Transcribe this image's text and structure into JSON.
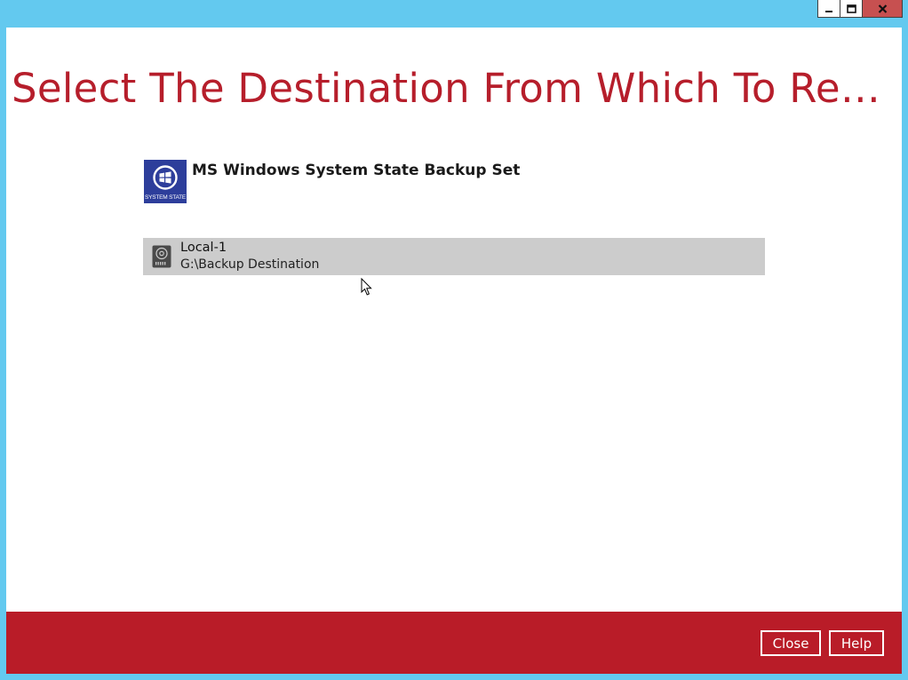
{
  "window": {
    "minimize_icon": "minimize-icon",
    "maximize_icon": "maximize-icon",
    "close_icon": "close-x-icon"
  },
  "page": {
    "title": "Select The Destination From Which To Restor…"
  },
  "backup_set": {
    "icon": "windows-system-state-icon",
    "icon_caption": "SYSTEM STATE",
    "name": "MS Windows System State Backup Set"
  },
  "destinations": [
    {
      "icon": "local-drive-icon",
      "name": "Local-1",
      "path": "G:\\Backup Destination",
      "selected": true
    }
  ],
  "footer": {
    "close_label": "Close",
    "help_label": "Help"
  },
  "colors": {
    "accent_red": "#b91c28",
    "title_red": "#b61e2b",
    "frame_blue": "#63c9ef",
    "row_highlight": "#cccccc",
    "icon_blue": "#2d3e9b"
  }
}
